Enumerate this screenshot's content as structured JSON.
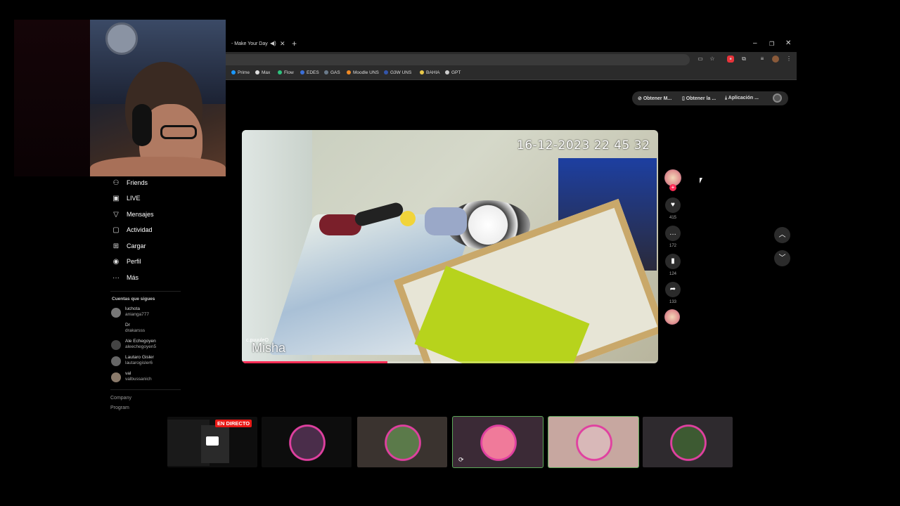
{
  "browser": {
    "tab_title": "- Make Your Day",
    "bookmarks": [
      {
        "label": "Prime",
        "color": "#1a98ff"
      },
      {
        "label": "Max",
        "color": "#dddddd"
      },
      {
        "label": "Flow",
        "color": "#2ec27e"
      },
      {
        "label": "EDES",
        "color": "#3b6fd8"
      },
      {
        "label": "GAS",
        "color": "#6a7a8a"
      },
      {
        "label": "Moodle UNS",
        "color": "#f08a24"
      },
      {
        "label": "G3W UNS",
        "color": "#3355aa"
      },
      {
        "label": "BAHIA",
        "color": "#e8c84a"
      },
      {
        "label": "GPT",
        "color": "#cccccc"
      }
    ]
  },
  "top_buttons": {
    "b1": "Obtener M...",
    "b2": "Obtener la ...",
    "b3": "Aplicación ..."
  },
  "sidebar": {
    "items": [
      {
        "label": "Friends",
        "icon": "friends-icon",
        "glyph": "⚇"
      },
      {
        "label": "LIVE",
        "icon": "live-icon",
        "glyph": "▣"
      },
      {
        "label": "Mensajes",
        "icon": "messages-icon",
        "glyph": "▽"
      },
      {
        "label": "Actividad",
        "icon": "activity-icon",
        "glyph": "▢"
      },
      {
        "label": "Cargar",
        "icon": "upload-icon",
        "glyph": "⊞"
      },
      {
        "label": "Perfil",
        "icon": "profile-icon",
        "glyph": "◉"
      },
      {
        "label": "Más",
        "icon": "more-icon",
        "glyph": "···"
      }
    ],
    "following_title": "Cuentas que sigues",
    "following": [
      {
        "name": "luchota",
        "handle": "anianga777"
      },
      {
        "name": "Dr",
        "handle": "drakarsss"
      },
      {
        "name": "Ale Echegoyen",
        "handle": "aleechegoyen5"
      },
      {
        "name": "Lautaro Gisler",
        "handle": "lautarogisler6"
      },
      {
        "name": "val",
        "handle": "valbussanich"
      }
    ],
    "footer": {
      "company": "Company",
      "program": "Program"
    }
  },
  "video": {
    "timestamp": "16-12-2023 22 45 32",
    "camera_name": "Misha",
    "uploader": "c.puuuleO",
    "progress": 0.35
  },
  "actions": {
    "likes": "415",
    "comments": "172",
    "saves": "124",
    "shares": "133"
  },
  "stream_strip": {
    "live_badge": "EN DIRECTO",
    "thumbs": [
      {
        "bg": "#0e0e0e",
        "border": "#000000",
        "emblem": "#333333"
      },
      {
        "bg": "#0d0d0d",
        "border": "#000000",
        "emblem": "#4a2d4a"
      },
      {
        "bg": "#3a332f",
        "border": "#000000",
        "emblem": "#5b7a4a"
      },
      {
        "bg": "#3b2a36",
        "border": "#5ba858",
        "emblem": "#f07a9a"
      },
      {
        "bg": "#c7a7a0",
        "border": "#5ba858",
        "emblem": "#d8b8b8"
      },
      {
        "bg": "#2e2a2e",
        "border": "#000000",
        "emblem": "#3d5a32"
      }
    ]
  }
}
